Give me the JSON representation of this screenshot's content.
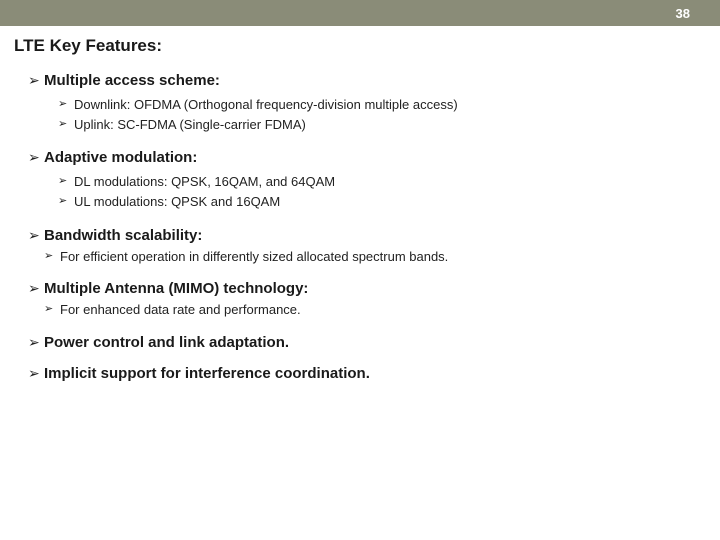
{
  "page_number": "38",
  "title": "LTE Key Features:",
  "bullet_glyph": "➢",
  "sections": [
    {
      "title": "Multiple access scheme:",
      "items": [
        "Downlink: OFDMA (Orthogonal frequency-division multiple access)",
        "Uplink: SC-FDMA (Single-carrier FDMA)"
      ]
    },
    {
      "title": "Adaptive modulation:",
      "items": [
        "DL modulations: QPSK, 16QAM, and 64QAM",
        "UL modulations: QPSK and 16QAM"
      ]
    },
    {
      "title": "Bandwidth scalability:",
      "items": [
        "For efficient operation in differently sized allocated spectrum bands."
      ],
      "tight": true
    },
    {
      "title": "Multiple Antenna (MIMO) technology:",
      "items": [
        "For enhanced data rate and performance."
      ],
      "tight": true
    },
    {
      "title": "Power control and link adaptation.",
      "items": []
    },
    {
      "title": "Implicit support for interference coordination.",
      "items": []
    }
  ]
}
